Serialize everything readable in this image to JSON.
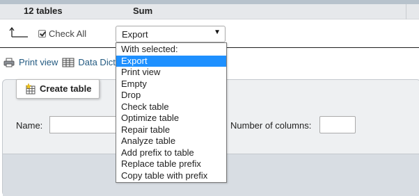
{
  "table_footer": {
    "table_count": "12 tables",
    "sum_label": "Sum"
  },
  "check_all_label": "Check All",
  "check_all_checked": true,
  "with_selected": {
    "current": "Export",
    "options": [
      "With selected:",
      "Export",
      "Print view",
      "Empty",
      "Drop",
      "Check table",
      "Optimize table",
      "Repair table",
      "Analyze table",
      "Add prefix to table",
      "Replace table prefix",
      "Copy table with prefix"
    ],
    "highlighted": "Export"
  },
  "links": {
    "print_view": "Print view",
    "data_dictionary": "Data Dict"
  },
  "create_table": {
    "legend": "Create table",
    "name_label": "Name:",
    "name_value": "",
    "columns_label": "Number of columns:",
    "columns_value": ""
  },
  "colors": {
    "link": "#235a81",
    "highlight": "#1e90ff"
  }
}
